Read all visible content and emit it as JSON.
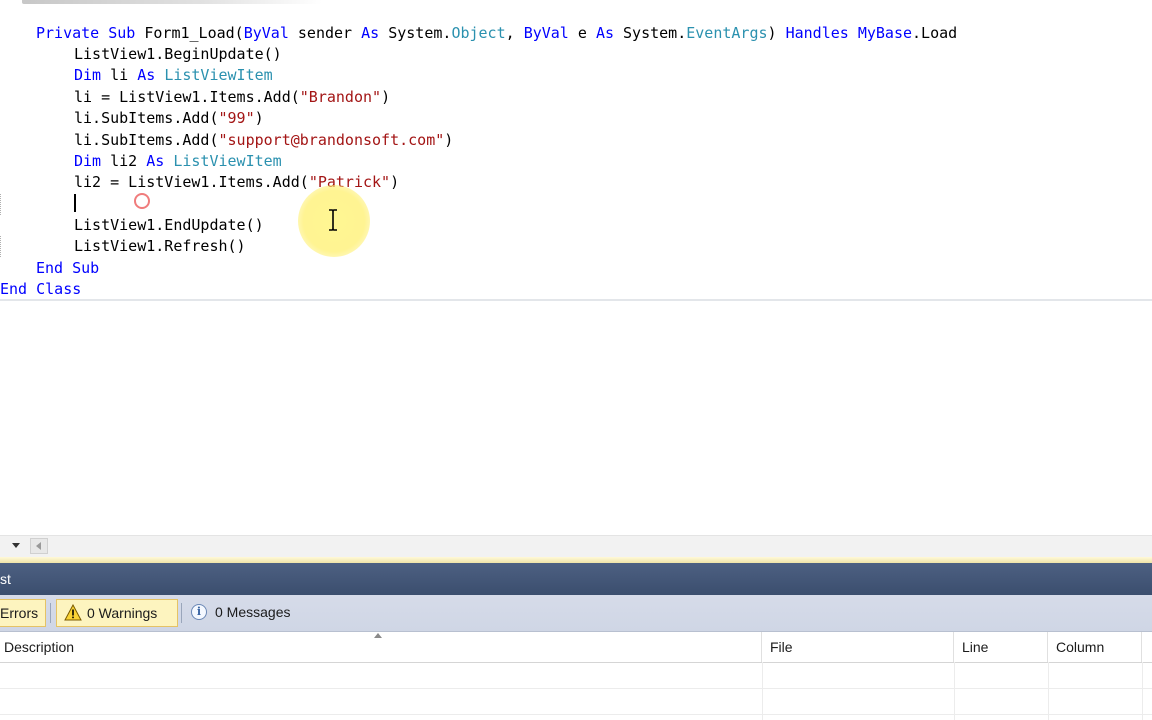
{
  "editor": {
    "lines": [
      [
        [
          "kw",
          "Private Sub"
        ],
        [
          "t",
          " Form1_Load("
        ],
        [
          "kw",
          "ByVal"
        ],
        [
          "t",
          " sender "
        ],
        [
          "kw",
          "As"
        ],
        [
          "t",
          " System."
        ],
        [
          "ty",
          "Object"
        ],
        [
          "t",
          ", "
        ],
        [
          "kw",
          "ByVal"
        ],
        [
          "t",
          " e "
        ],
        [
          "kw",
          "As"
        ],
        [
          "t",
          " System."
        ],
        [
          "ty",
          "EventArgs"
        ],
        [
          "t",
          ") "
        ],
        [
          "kw",
          "Handles"
        ],
        [
          "t",
          " "
        ],
        [
          "kw",
          "MyBase"
        ],
        [
          "t",
          ".Load"
        ]
      ],
      [
        [
          "t",
          "ListView1.BeginUpdate()"
        ]
      ],
      [
        [
          "kw",
          "Dim"
        ],
        [
          "t",
          " li "
        ],
        [
          "kw",
          "As"
        ],
        [
          "t",
          " "
        ],
        [
          "ty",
          "ListViewItem"
        ]
      ],
      [
        [
          "t",
          "li = ListView1.Items.Add("
        ],
        [
          "st",
          "\"Brandon\""
        ],
        [
          "t",
          ")"
        ]
      ],
      [
        [
          "t",
          "li.SubItems.Add("
        ],
        [
          "st",
          "\"99\""
        ],
        [
          "t",
          ")"
        ]
      ],
      [
        [
          "t",
          "li.SubItems.Add("
        ],
        [
          "st",
          "\"support@brandonsoft.com\""
        ],
        [
          "t",
          ")"
        ]
      ],
      [
        [
          "kw",
          "Dim"
        ],
        [
          "t",
          " li2 "
        ],
        [
          "kw",
          "As"
        ],
        [
          "t",
          " "
        ],
        [
          "ty",
          "ListViewItem"
        ]
      ],
      [
        [
          "t",
          "li2 = ListView1.Items.Add("
        ],
        [
          "st",
          "\"Patrick\""
        ],
        [
          "t",
          ")"
        ]
      ],
      [
        [
          "t",
          ""
        ]
      ],
      [
        [
          "t",
          "ListView1.EndUpdate()"
        ]
      ],
      [
        [
          "t",
          "ListView1.Refresh()"
        ]
      ],
      [
        [
          "kw",
          "End Sub"
        ]
      ],
      [
        [
          "kw",
          "End Class"
        ]
      ]
    ]
  },
  "error_list": {
    "title": "st",
    "filters": {
      "errors_label": "Errors",
      "warnings_label": "0 Warnings",
      "messages_label": "0 Messages"
    },
    "columns": {
      "description": "Description",
      "file": "File",
      "line": "Line",
      "column": "Column"
    }
  },
  "colors": {
    "keyword": "#0000ff",
    "type": "#2b91af",
    "string": "#a31515",
    "panel_title_bg": "#4d6082",
    "filter_active_bg": "#fdf4bf"
  },
  "icons": {
    "warning": "warning-triangle-icon",
    "info": "info-circle-icon",
    "dropdown": "chevron-down-icon",
    "scroll_left": "scroll-left-arrow-icon",
    "cursor": "ibeam-cursor-icon"
  }
}
